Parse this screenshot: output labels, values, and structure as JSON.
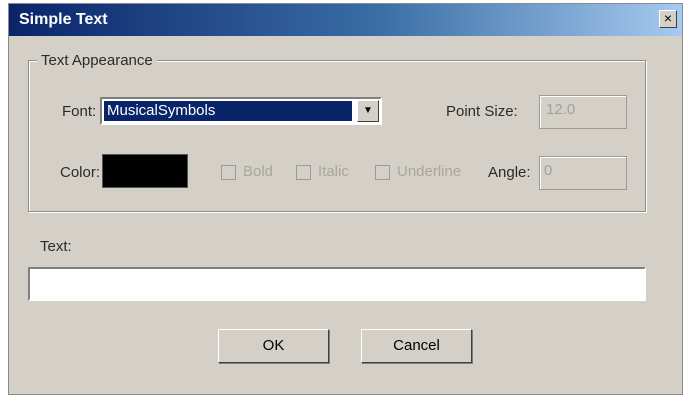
{
  "window": {
    "title": "Simple Text",
    "close_glyph": "×"
  },
  "appearance_group": {
    "legend": "Text Appearance",
    "font_label": "Font:",
    "font_value": "MusicalSymbols",
    "dropdown_glyph": "▼",
    "point_size_label": "Point Size:",
    "point_size_value": "12.0",
    "color_label": "Color:",
    "color_value": "#000000",
    "bold_label": "Bold",
    "italic_label": "Italic",
    "underline_label": "Underline",
    "angle_label": "Angle:",
    "angle_value": "0"
  },
  "text": {
    "label": "Text:",
    "value": ""
  },
  "buttons": {
    "ok_label": "OK",
    "cancel_label": "Cancel"
  }
}
